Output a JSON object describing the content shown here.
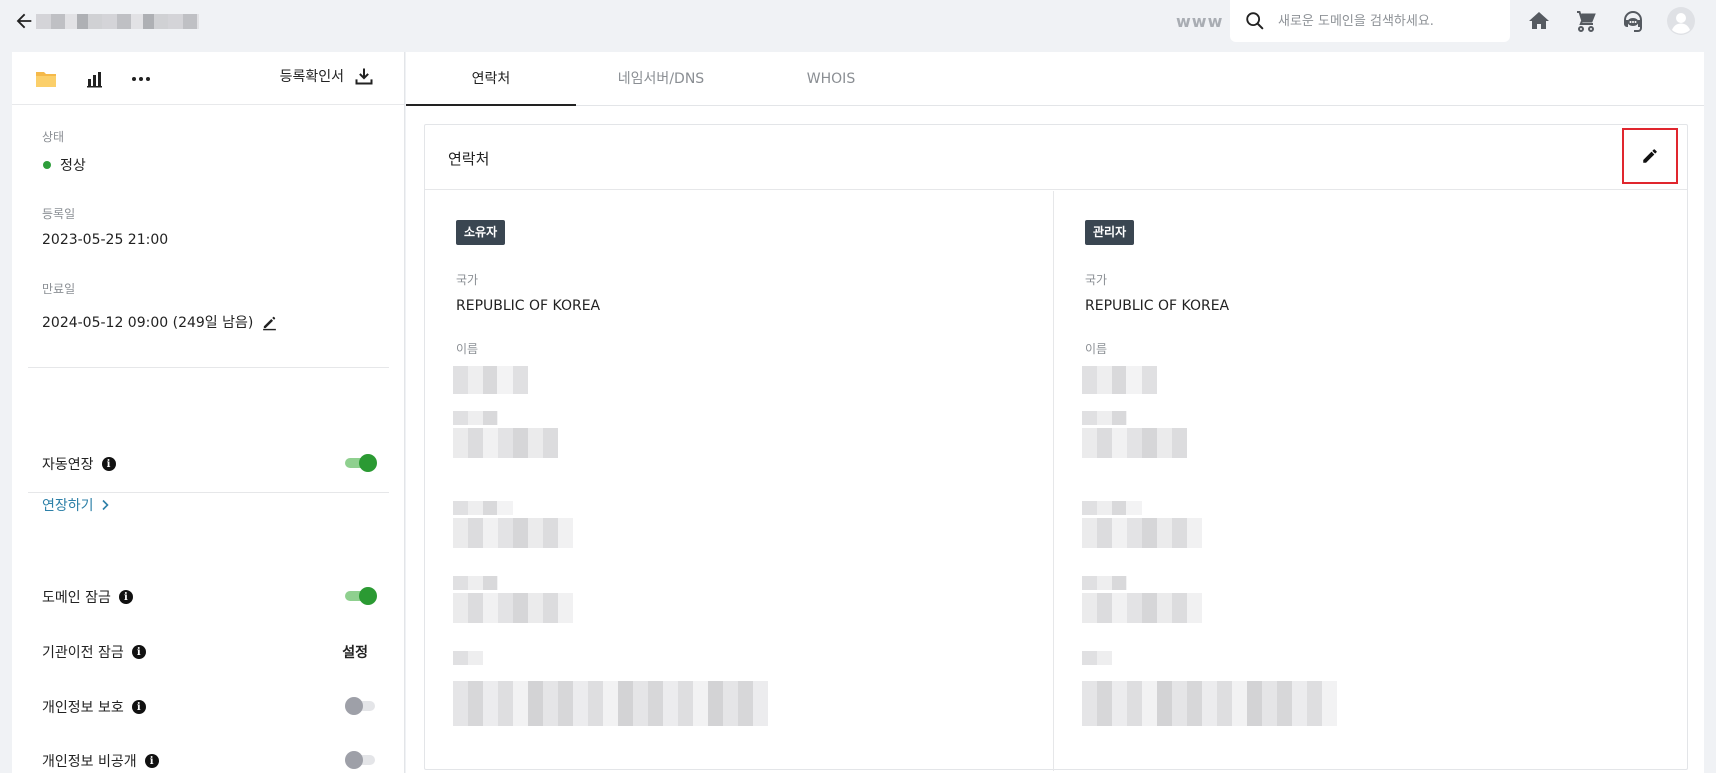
{
  "topbar": {
    "www_label": "www",
    "search_placeholder": "새로운 도메인을 검색하세요."
  },
  "left": {
    "certificate_label": "등록확인서",
    "status_label": "상태",
    "status_value": "정상",
    "registered_label": "등록일",
    "registered_value": "2023-05-25 21:00",
    "expiry_label": "만료일",
    "expiry_value": "2024-05-12 09:00 (249일 남음)",
    "auto_renew_label": "자동연장",
    "auto_renew_on": true,
    "renew_link": "연장하기",
    "domain_lock_label": "도메인 잠금",
    "domain_lock_on": true,
    "registrar_lock_label": "기관이전 잠금",
    "registrar_lock_action": "설정",
    "privacy_label": "개인정보 보호",
    "privacy_on": false,
    "nondisclosure_label": "개인정보 비공개",
    "nondisclosure_on": false
  },
  "tabs": [
    {
      "label": "연락처",
      "active": true
    },
    {
      "label": "네임서버/DNS",
      "active": false
    },
    {
      "label": "WHOIS",
      "active": false
    }
  ],
  "contact": {
    "title": "연락처",
    "owner": {
      "badge": "소유자",
      "country_label": "국가",
      "country_value": "REPUBLIC OF KOREA",
      "name_label": "이름"
    },
    "admin": {
      "badge": "관리자",
      "country_label": "국가",
      "country_value": "REPUBLIC OF KOREA",
      "name_label": "이름"
    }
  },
  "colors": {
    "accent_green": "#2b9a33",
    "link_blue": "#2d80a8",
    "badge_dark": "#3a4651",
    "highlight_red": "#e0262e"
  }
}
